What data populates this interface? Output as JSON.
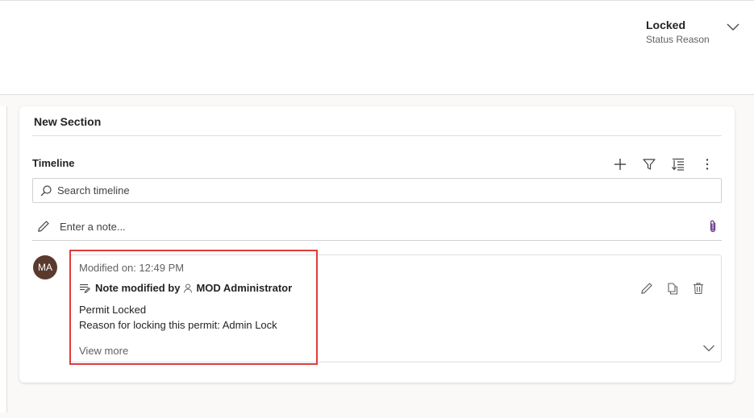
{
  "header": {
    "status_value": "Locked",
    "status_label": "Status Reason"
  },
  "section": {
    "title": "New Section"
  },
  "timeline": {
    "title": "Timeline",
    "search_placeholder": "Search timeline",
    "note_placeholder": "Enter a note...",
    "entries": [
      {
        "avatar_initials": "MA",
        "avatar_color": "#5b3a2e",
        "modified": "Modified on: 12:49 PM",
        "title_prefix": "Note modified by",
        "author": "MOD Administrator",
        "line1": "Permit Locked",
        "line2": "Reason for locking this permit: Admin Lock",
        "view_more": "View more"
      }
    ]
  },
  "colors": {
    "highlight": "#e03c3c",
    "attachment": "#6b3d8f"
  }
}
